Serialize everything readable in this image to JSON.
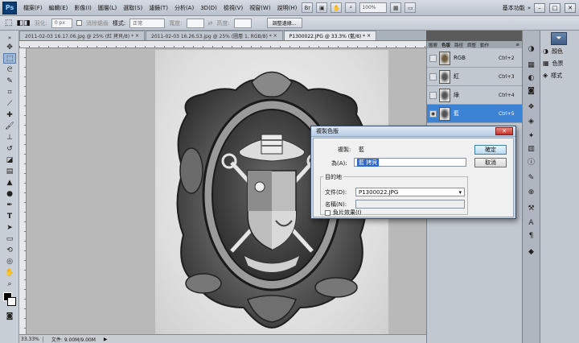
{
  "menubar": {
    "logo": "Ps",
    "items": [
      "檔案(F)",
      "編輯(E)",
      "影像(I)",
      "圖層(L)",
      "選取(S)",
      "濾鏡(T)",
      "分析(A)",
      "3D(D)",
      "檢視(V)",
      "視窗(W)",
      "說明(H)"
    ],
    "zoom": "100%",
    "workspace": "基本功能",
    "window_buttons": [
      "–",
      "□",
      "✕"
    ]
  },
  "options": {
    "feather_label": "羽化:",
    "feather_value": "0 px",
    "antialias_label": "消除鋸齒",
    "style_label": "樣式:",
    "style_value": "正常",
    "width_label": "寬度:",
    "height_label": "高度:",
    "refine_button": "調整邊緣..."
  },
  "tabs": [
    {
      "label": "2011-02-03 16.17.06.jpg @ 25% (紅 拷貝/8) *",
      "active": false
    },
    {
      "label": "2011-02-03 16.26.53.jpg @ 25% (圖層 1, RGB/8) *",
      "active": false
    },
    {
      "label": "P1300022.JPG @ 33.3% (藍/8) *",
      "active": true
    }
  ],
  "status": {
    "zoom": "33.33%",
    "doc": "文件: 9.00M/9.00M"
  },
  "panel": {
    "tabs": [
      "圖層",
      "色版",
      "路徑",
      "調整",
      "動作"
    ],
    "channels": [
      {
        "name": "RGB",
        "shortcut": "Ctrl+2",
        "selected": false
      },
      {
        "name": "紅",
        "shortcut": "Ctrl+3",
        "selected": false
      },
      {
        "name": "綠",
        "shortcut": "Ctrl+4",
        "selected": false
      },
      {
        "name": "藍",
        "shortcut": "Ctrl+5",
        "selected": true
      }
    ]
  },
  "dock": {
    "labels": [
      "顏色",
      "色票",
      "樣式"
    ]
  },
  "dialog": {
    "title": "複製色版",
    "close": "✕",
    "duplicate_label": "複製:",
    "duplicate_value": "藍",
    "as_label": "為(A):",
    "as_value": "藍 拷貝",
    "destination_label": "目的地",
    "document_label": "文件(D):",
    "document_value": "P1300022.JPG",
    "name_label": "名稱(N):",
    "name_value": "",
    "invert_label": "負片效果(I)",
    "ok_label": "確定",
    "cancel_label": "取消"
  },
  "colors": {
    "selected_row": "#3c83d6",
    "dialog_frame": "#c7d8ec"
  }
}
